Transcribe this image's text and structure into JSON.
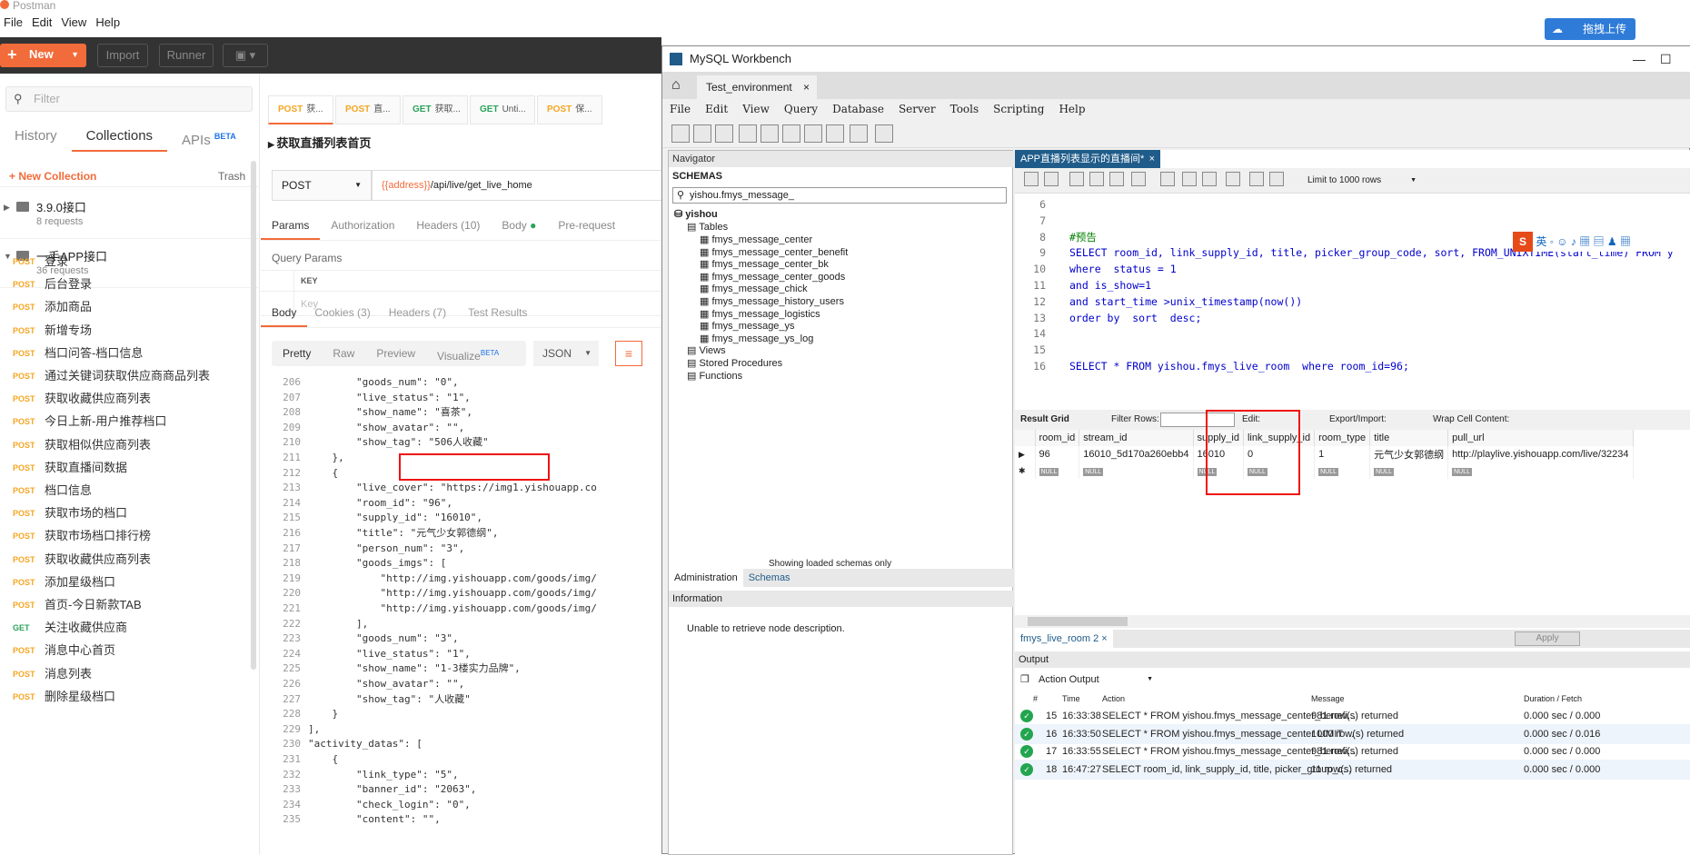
{
  "postman": {
    "title": "Postman",
    "menu": [
      "File",
      "Edit",
      "View",
      "Help"
    ],
    "toolbar": {
      "new": "New",
      "import": "Import",
      "runner": "Runner"
    },
    "sidebar": {
      "filter_placeholder": "Filter",
      "tabs": [
        "History",
        "Collections",
        "APIs"
      ],
      "apis_badge": "BETA",
      "new_collection": "+ New Collection",
      "trash": "Trash",
      "collections": [
        {
          "name": "3.9.0接口",
          "count": "8 requests"
        },
        {
          "name": "一手APP接口",
          "count": "36 requests"
        }
      ],
      "requests": [
        {
          "method": "POST",
          "name": "登录"
        },
        {
          "method": "POST",
          "name": "后台登录"
        },
        {
          "method": "POST",
          "name": "添加商品"
        },
        {
          "method": "POST",
          "name": "新增专场"
        },
        {
          "method": "POST",
          "name": "档口问答-档口信息"
        },
        {
          "method": "POST",
          "name": "通过关键词获取供应商商品列表"
        },
        {
          "method": "POST",
          "name": "获取收藏供应商列表"
        },
        {
          "method": "POST",
          "name": "今日上新-用户推荐档口"
        },
        {
          "method": "POST",
          "name": "获取相似供应商列表"
        },
        {
          "method": "POST",
          "name": "获取直播间数据"
        },
        {
          "method": "POST",
          "name": "档口信息"
        },
        {
          "method": "POST",
          "name": "获取市场的档口"
        },
        {
          "method": "POST",
          "name": "获取市场档口排行榜"
        },
        {
          "method": "POST",
          "name": "获取收藏供应商列表"
        },
        {
          "method": "POST",
          "name": "添加星级档口"
        },
        {
          "method": "POST",
          "name": "首页-今日新款TAB"
        },
        {
          "method": "GET",
          "name": "关注收藏供应商"
        },
        {
          "method": "POST",
          "name": "消息中心首页"
        },
        {
          "method": "POST",
          "name": "消息列表"
        },
        {
          "method": "POST",
          "name": "删除星级档口"
        }
      ]
    },
    "tabs": [
      {
        "method": "POST",
        "label": "获..."
      },
      {
        "method": "POST",
        "label": "直..."
      },
      {
        "method": "GET",
        "label": "获取..."
      },
      {
        "method": "GET",
        "label": "Unti..."
      },
      {
        "method": "POST",
        "label": "保..."
      }
    ],
    "request_title": "获取直播列表首页",
    "method": "POST",
    "url_var": "{{address}}",
    "url_path": "/api/live/get_live_home",
    "req_tabs": [
      "Params",
      "Authorization",
      "Headers (10)",
      "Body",
      "Pre-request"
    ],
    "query_params": "Query Params",
    "key_header": "KEY",
    "key_placeholder": "Key",
    "resp_tabs": [
      "Body",
      "Cookies (3)",
      "Headers (7)",
      "Test Results"
    ],
    "view_modes": [
      "Pretty",
      "Raw",
      "Preview",
      "Visualize"
    ],
    "visualize_badge": "BETA",
    "format": "JSON",
    "code": [
      {
        "n": "206",
        "t": "        \"goods_num\": \"0\","
      },
      {
        "n": "207",
        "t": "        \"live_status\": \"1\","
      },
      {
        "n": "208",
        "t": "        \"show_name\": \"喜茶\","
      },
      {
        "n": "209",
        "t": "        \"show_avatar\": \"\","
      },
      {
        "n": "210",
        "t": "        \"show_tag\": \"506人收藏\""
      },
      {
        "n": "211",
        "t": "    },"
      },
      {
        "n": "212",
        "t": "    {"
      },
      {
        "n": "213",
        "t": "        \"live_cover\": \"https://img1.yishouapp.co"
      },
      {
        "n": "214",
        "t": "        \"room_id\": \"96\","
      },
      {
        "n": "215",
        "t": "        \"supply_id\": \"16010\","
      },
      {
        "n": "216",
        "t": "        \"title\": \"元气少女郭德纲\","
      },
      {
        "n": "217",
        "t": "        \"person_num\": \"3\","
      },
      {
        "n": "218",
        "t": "        \"goods_imgs\": ["
      },
      {
        "n": "219",
        "t": "            \"http://img.yishouapp.com/goods/img/"
      },
      {
        "n": "220",
        "t": "            \"http://img.yishouapp.com/goods/img/"
      },
      {
        "n": "221",
        "t": "            \"http://img.yishouapp.com/goods/img/"
      },
      {
        "n": "222",
        "t": "        ],"
      },
      {
        "n": "223",
        "t": "        \"goods_num\": \"3\","
      },
      {
        "n": "224",
        "t": "        \"live_status\": \"1\","
      },
      {
        "n": "225",
        "t": "        \"show_name\": \"1-3楼实力品牌\","
      },
      {
        "n": "226",
        "t": "        \"show_avatar\": \"\","
      },
      {
        "n": "227",
        "t": "        \"show_tag\": \"人收藏\""
      },
      {
        "n": "228",
        "t": "    }"
      },
      {
        "n": "229",
        "t": "],"
      },
      {
        "n": "230",
        "t": "\"activity_datas\": ["
      },
      {
        "n": "231",
        "t": "    {"
      },
      {
        "n": "232",
        "t": "        \"link_type\": \"5\","
      },
      {
        "n": "233",
        "t": "        \"banner_id\": \"2063\","
      },
      {
        "n": "234",
        "t": "        \"check_login\": \"0\","
      },
      {
        "n": "235",
        "t": "        \"content\": \"\","
      }
    ]
  },
  "workbench": {
    "title": "MySQL Workbench",
    "conn_tab": "Test_environment",
    "upload_btn": "拖拽上传",
    "menu": [
      "File",
      "Edit",
      "View",
      "Query",
      "Database",
      "Server",
      "Tools",
      "Scripting",
      "Help"
    ],
    "navigator_label": "Navigator",
    "schemas_label": "SCHEMAS",
    "schema_filter": "yishou.fmys_message_",
    "schema_name": "yishou",
    "tables_label": "Tables",
    "tables": [
      "fmys_message_center",
      "fmys_message_center_benefit",
      "fmys_message_center_bk",
      "fmys_message_center_goods",
      "fmys_message_chick",
      "fmys_message_history_users",
      "fmys_message_logistics",
      "fmys_message_ys",
      "fmys_message_ys_log"
    ],
    "views_label": "Views",
    "procs_label": "Stored Procedures",
    "funcs_label": "Functions",
    "loaded_note": "Showing loaded schemas only",
    "bottom_tabs": [
      "Administration",
      "Schemas"
    ],
    "info_label": "Information",
    "info_text": "Unable to retrieve node description.",
    "query_tab": "APP直播列表显示的直播间*",
    "limit": "Limit to 1000 rows",
    "ime_label": "英",
    "sql": [
      {
        "n": "6",
        "t": ""
      },
      {
        "n": "7",
        "t": ""
      },
      {
        "n": "8",
        "t": "#预告"
      },
      {
        "n": "9",
        "t": "SELECT room_id, link_supply_id, title, picker_group_code, sort, FROM_UNIXTIME(start_time) FROM y"
      },
      {
        "n": "10",
        "t": "where  status = 1"
      },
      {
        "n": "11",
        "t": "and is_show=1"
      },
      {
        "n": "12",
        "t": "and start_time >unix_timestamp(now())"
      },
      {
        "n": "13",
        "t": "order by  sort  desc;"
      },
      {
        "n": "14",
        "t": ""
      },
      {
        "n": "15",
        "t": ""
      },
      {
        "n": "16",
        "t": "SELECT * FROM yishou.fmys_live_room  where room_id=96;"
      }
    ],
    "result_toolbar": {
      "grid": "Result Grid",
      "filter": "Filter Rows:",
      "edit": "Edit:",
      "export": "Export/Import:",
      "wrap": "Wrap Cell Content:"
    },
    "columns": [
      "room_id",
      "stream_id",
      "supply_id",
      "link_supply_id",
      "room_type",
      "title",
      "pull_url"
    ],
    "row": [
      "96",
      "16010_5d170a260ebb4",
      "16010",
      "0",
      "1",
      "元气少女郭德纲",
      "http://playlive.yishouapp.com/live/32234"
    ],
    "null_label": "NULL",
    "result_tab": "fmys_live_room 2",
    "apply": "Apply",
    "output_label": "Output",
    "action_output": "Action Output",
    "out_headers": [
      "#",
      "Time",
      "Action",
      "Message",
      "Duration / Fetch"
    ],
    "output": [
      {
        "n": "15",
        "time": "16:33:38",
        "action": "SELECT * FROM yishou.fmys_message_center_benefi...",
        "msg": "981 row(s) returned",
        "dur": "0.000 sec / 0.000"
      },
      {
        "n": "16",
        "time": "16:33:50",
        "action": "SELECT * FROM yishou.fmys_message_center LIMIT ...",
        "msg": "1000 row(s) returned",
        "dur": "0.000 sec / 0.016"
      },
      {
        "n": "17",
        "time": "16:33:55",
        "action": "SELECT * FROM yishou.fmys_message_center_benefi...",
        "msg": "981 row(s) returned",
        "dur": "0.000 sec / 0.000"
      },
      {
        "n": "18",
        "time": "16:47:27",
        "action": "SELECT room_id, link_supply_id, title, picker_group_c...",
        "msg": "11 row(s) returned",
        "dur": "0.000 sec / 0.000"
      }
    ]
  }
}
